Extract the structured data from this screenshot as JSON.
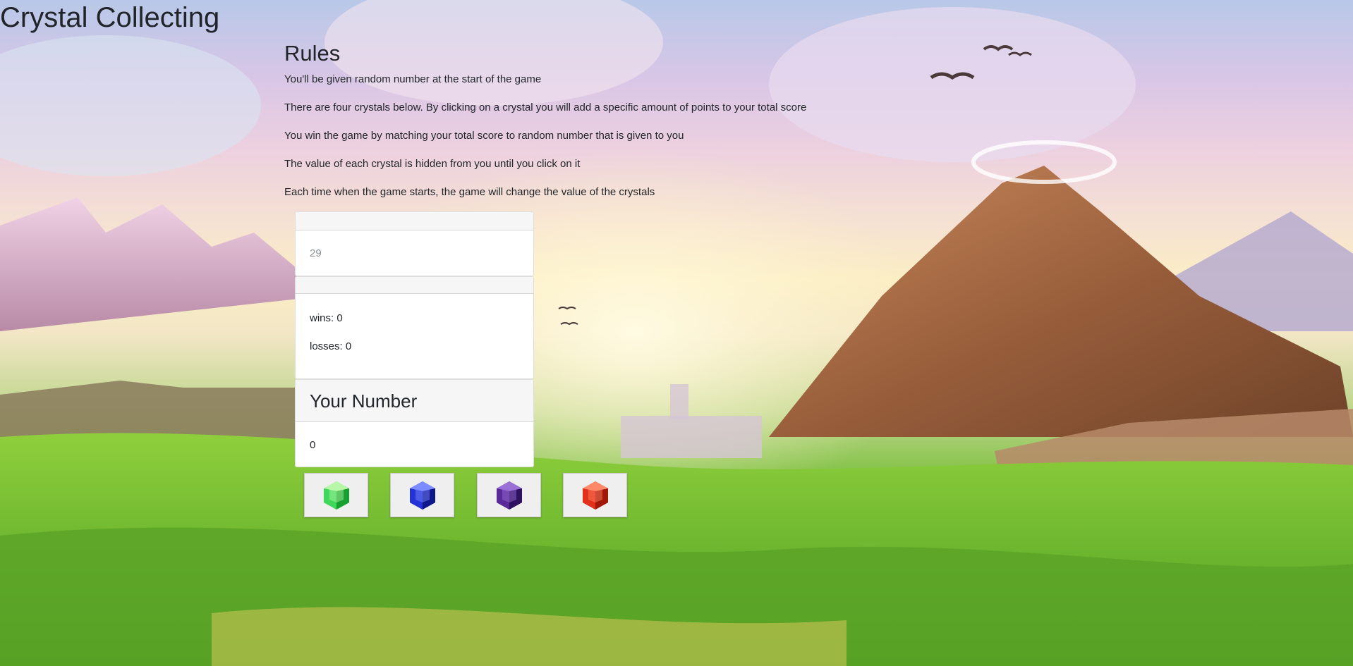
{
  "app": {
    "title": "Crystal Collecting"
  },
  "rules": {
    "heading": "Rules",
    "lines": [
      "You'll be given random number at the start of the game",
      "There are four crystals below. By clicking on a crystal you will add a specific amount of points to your total score",
      "You win the game by matching your total score to random number that is given to you",
      "The value of each crystal is hidden from you until you click on it",
      "Each time when the game starts, the game will change the value of the crystals"
    ]
  },
  "target": {
    "value": "29"
  },
  "stats": {
    "wins_text": "wins: 0",
    "losses_text": "losses: 0"
  },
  "your_number": {
    "heading": "Your Number",
    "value": "0"
  },
  "crystals": [
    {
      "name": "green-crystal-icon",
      "color": "#3fd85a",
      "light": "#b9f7a8",
      "dark": "#17a02f"
    },
    {
      "name": "blue-crystal-icon",
      "color": "#2433d6",
      "light": "#7d8cff",
      "dark": "#0f188a"
    },
    {
      "name": "purple-crystal-icon",
      "color": "#5a2a9a",
      "light": "#9a6fd6",
      "dark": "#2e1160"
    },
    {
      "name": "red-crystal-icon",
      "color": "#e3301a",
      "light": "#ff8a6a",
      "dark": "#a11708"
    }
  ]
}
